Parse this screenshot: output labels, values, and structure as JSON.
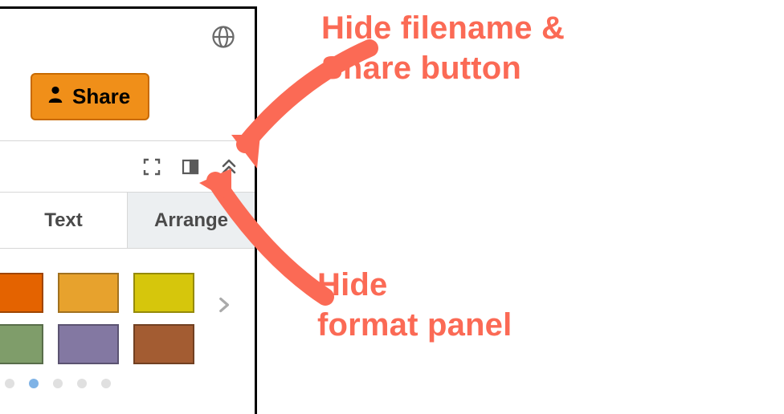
{
  "header": {
    "share_label": "Share"
  },
  "tabs": {
    "text_label": "Text",
    "arrange_label": "Arrange"
  },
  "colors": {
    "row1": [
      "#e46300",
      "#e7a22d",
      "#d6c60c"
    ],
    "row2": [
      "#7f9d6a",
      "#8378a2",
      "#a35c32"
    ]
  },
  "icons": {
    "globe": "globe-icon",
    "person": "person-icon",
    "fullscreen": "fullscreen-icon",
    "panel_toggle": "panel-toggle-icon",
    "collapse": "collapse-chevrons-icon",
    "chevron_right": "chevron-right-icon"
  },
  "annotations": {
    "hide_filename": "Hide filename &\nShare button",
    "hide_format": "Hide\nformat panel"
  }
}
